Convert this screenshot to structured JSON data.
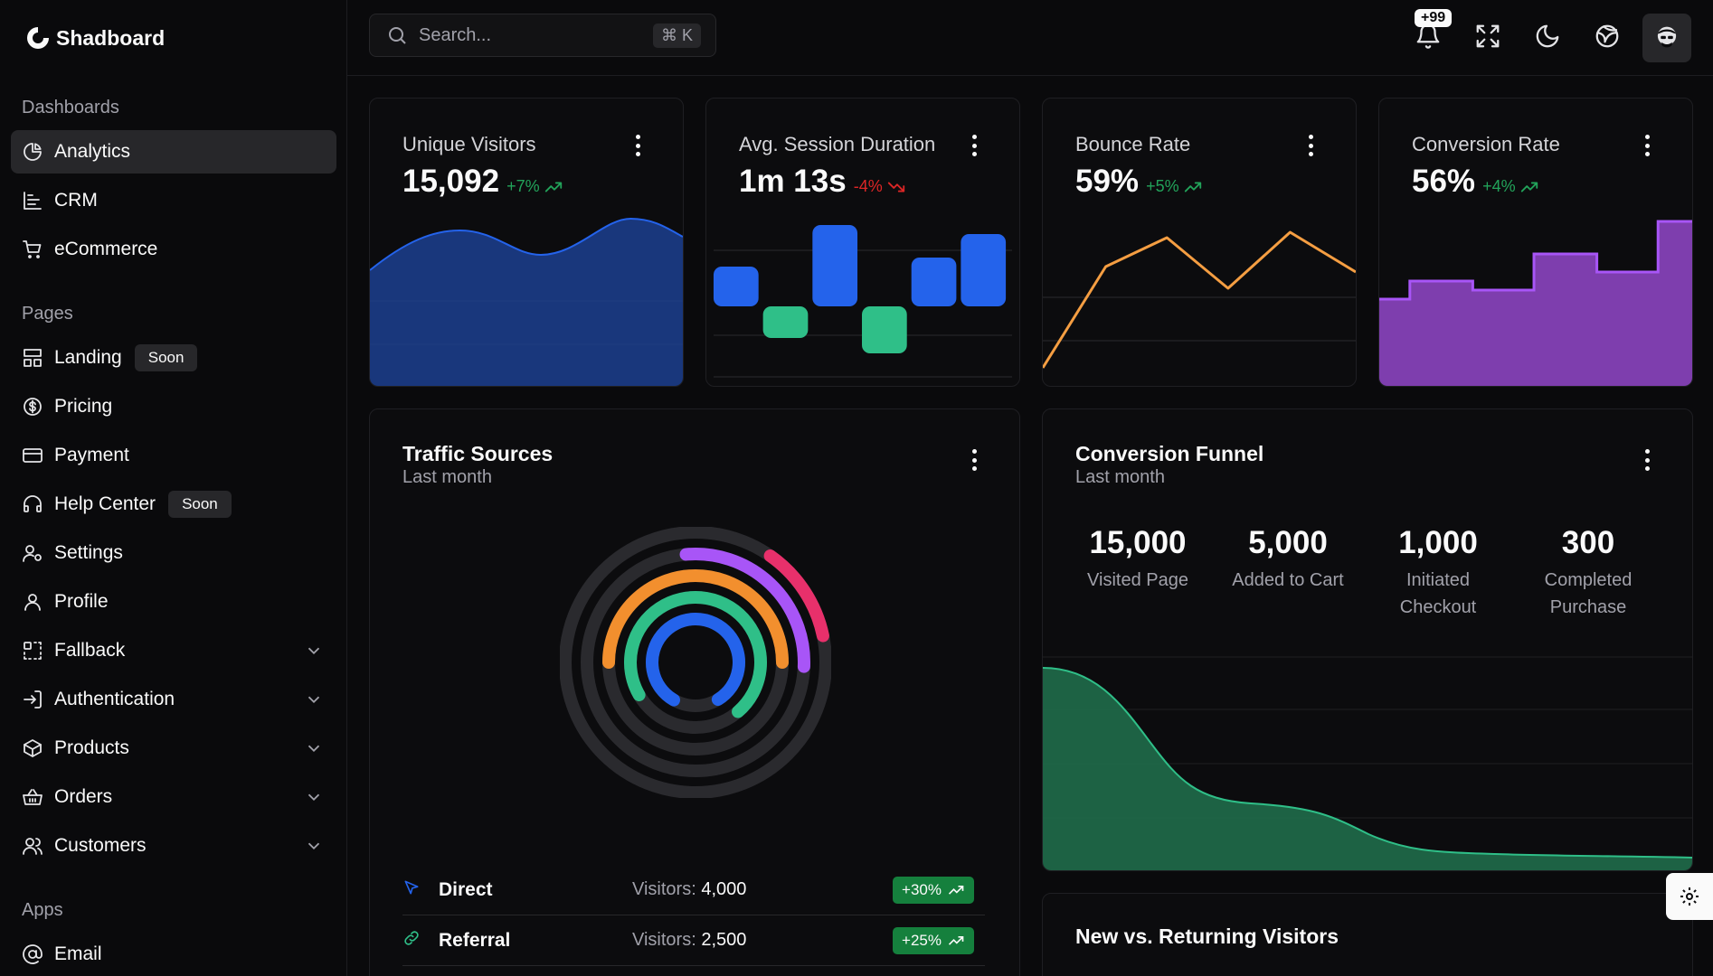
{
  "brand": {
    "name": "Shadboard"
  },
  "search": {
    "placeholder": "Search...",
    "shortcut": "⌘ K"
  },
  "header": {
    "notification_count": "+99"
  },
  "sidebar": {
    "sections": [
      {
        "label": "Dashboards"
      },
      {
        "label": "Pages"
      },
      {
        "label": "Apps"
      }
    ],
    "items": [
      {
        "label": "Analytics",
        "icon": "chart-pie-icon"
      },
      {
        "label": "CRM",
        "icon": "chart-bar-icon"
      },
      {
        "label": "eCommerce",
        "icon": "cart-icon"
      },
      {
        "label": "Landing",
        "icon": "layout-icon",
        "badge": "Soon"
      },
      {
        "label": "Pricing",
        "icon": "dollar-circle-icon"
      },
      {
        "label": "Payment",
        "icon": "credit-card-icon"
      },
      {
        "label": "Help Center",
        "icon": "headset-icon",
        "badge": "Soon"
      },
      {
        "label": "Settings",
        "icon": "user-cog-icon"
      },
      {
        "label": "Profile",
        "icon": "user-icon"
      },
      {
        "label": "Fallback",
        "icon": "fallback-icon"
      },
      {
        "label": "Authentication",
        "icon": "login-icon"
      },
      {
        "label": "Products",
        "icon": "package-icon"
      },
      {
        "label": "Orders",
        "icon": "basket-icon"
      },
      {
        "label": "Customers",
        "icon": "users-icon"
      },
      {
        "label": "Email",
        "icon": "at-sign-icon"
      }
    ]
  },
  "stats": [
    {
      "title": "Unique Visitors",
      "value": "15,092",
      "delta": "+7%",
      "trend": "up",
      "color": "#2463eb"
    },
    {
      "title": "Avg. Session Duration",
      "value": "1m 13s",
      "delta": "-4%",
      "trend": "down",
      "color": "#2463eb"
    },
    {
      "title": "Bounce Rate",
      "value": "59%",
      "delta": "+5%",
      "trend": "up",
      "color": "#f59e42"
    },
    {
      "title": "Conversion Rate",
      "value": "56%",
      "delta": "+4%",
      "trend": "up",
      "color": "#9b4fd6"
    }
  ],
  "traffic": {
    "title": "Traffic Sources",
    "subtitle": "Last month",
    "visitors_label": "Visitors:",
    "rows": [
      {
        "name": "Direct",
        "visitors": "4,000",
        "change": "+30%",
        "icon": "cursor-icon"
      },
      {
        "name": "Referral",
        "visitors": "2,500",
        "change": "+25%",
        "icon": "link-icon"
      }
    ],
    "rings": [
      {
        "color": "#2463eb",
        "fraction": 0.83
      },
      {
        "color": "#2fbf88",
        "fraction": 0.72
      },
      {
        "color": "#f28f2e",
        "fraction": 0.5
      },
      {
        "color": "#a855f7",
        "fraction": 0.27
      },
      {
        "color": "#e8306b",
        "fraction": 0.12
      }
    ]
  },
  "funnel": {
    "title": "Conversion Funnel",
    "subtitle": "Last month",
    "stages": [
      {
        "value": "15,000",
        "label": "Visited Page"
      },
      {
        "value": "5,000",
        "label": "Added to Cart"
      },
      {
        "value": "1,000",
        "label": "Initiated Checkout"
      },
      {
        "value": "300",
        "label": "Completed Purchase"
      }
    ]
  },
  "returning": {
    "title": "New vs. Returning Visitors"
  }
}
